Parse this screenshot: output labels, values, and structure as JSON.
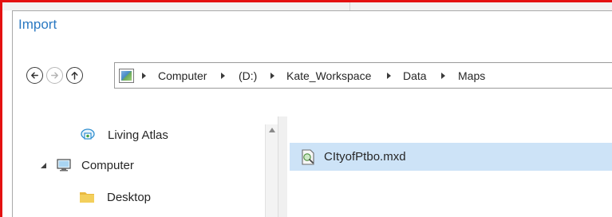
{
  "dialog": {
    "title": "Import"
  },
  "navigation": {
    "back_icon": "back-arrow-icon",
    "forward_icon": "forward-arrow-icon",
    "up_icon": "up-arrow-icon",
    "breadcrumb": [
      "Computer",
      "(D:)",
      "Kate_Workspace",
      "Data",
      "Maps"
    ]
  },
  "tree": {
    "items": [
      {
        "label": "Living Atlas",
        "icon": "living-atlas-icon"
      },
      {
        "label": "Computer",
        "icon": "computer-icon"
      },
      {
        "label": "Desktop",
        "icon": "folder-icon"
      }
    ]
  },
  "files": [
    {
      "name": "CItyofPtbo.mxd",
      "icon": "map-document-icon",
      "selected": true
    }
  ],
  "colors": {
    "frame_border": "#e41111",
    "title": "#2b79c2",
    "selection": "#cde3f7"
  }
}
